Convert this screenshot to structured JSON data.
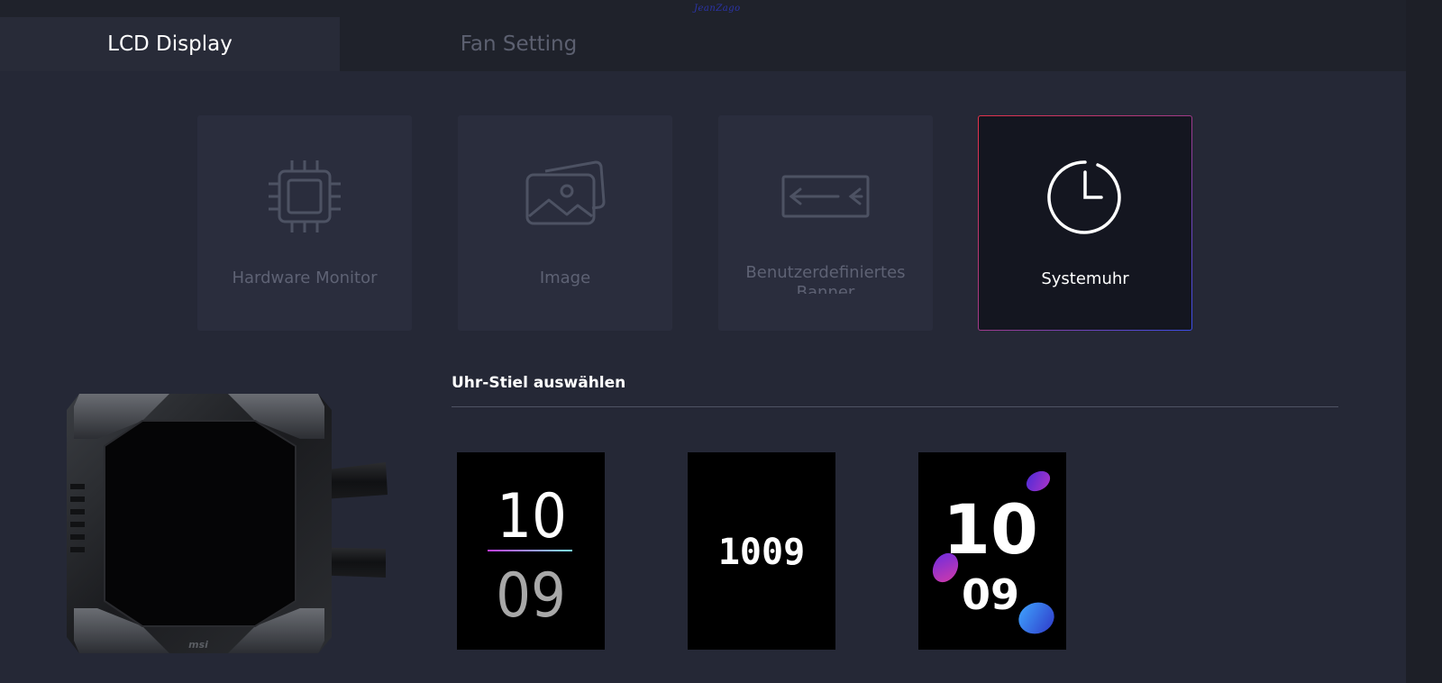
{
  "signature": "JeanZago",
  "tabs": {
    "lcd_display": "LCD Display",
    "fan_setting": "Fan Setting"
  },
  "modes": [
    {
      "label": "Hardware Monitor",
      "icon": "cpu-chip-icon"
    },
    {
      "label": "Image",
      "icon": "image-stack-icon"
    },
    {
      "label": "Benutzerdefiniertes Banner",
      "icon": "banner-scroll-icon"
    },
    {
      "label": "Systemuhr",
      "icon": "clock-icon"
    }
  ],
  "selected_mode": "Systemuhr",
  "section": {
    "title": "Uhr-Stiel auswählen"
  },
  "clock_styles": [
    {
      "hours": "10",
      "minutes": "09"
    },
    {
      "digits": "1009"
    },
    {
      "hours": "10",
      "minutes": "09"
    }
  ],
  "device": {
    "brand_logo": "msi"
  },
  "colors": {
    "active_border_start": "#e5324a",
    "active_border_end": "#3a4de8",
    "inactive_text": "#5e6274"
  }
}
